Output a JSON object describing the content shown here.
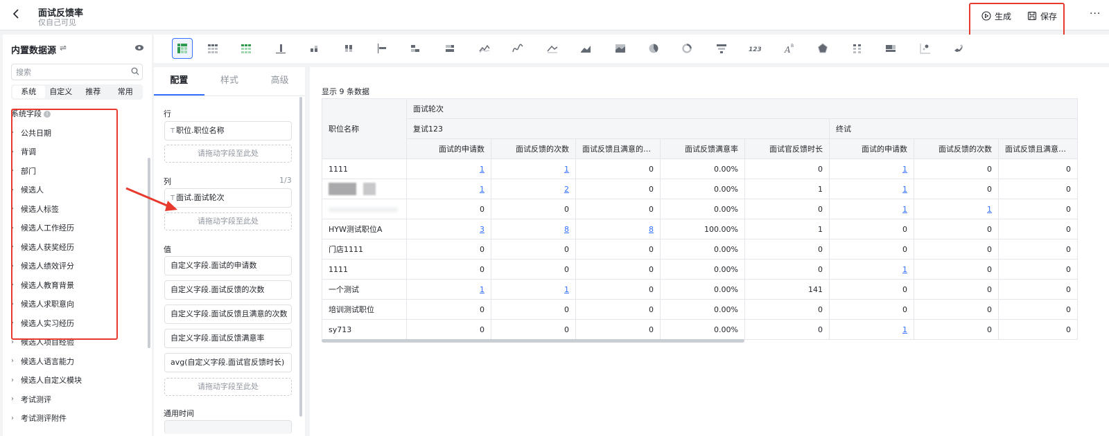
{
  "header": {
    "back_icon": "chevron-left-icon",
    "title": "面试反馈率",
    "subtitle": "仅自己可见",
    "generate_label": "生成",
    "save_label": "保存",
    "more_label": "···",
    "highlight_color": "#e8392d"
  },
  "left_panel": {
    "title": "内置数据源",
    "search_placeholder": "搜索",
    "tabs": [
      "系统",
      "自定义",
      "推荐",
      "常用"
    ],
    "active_tab": "系统",
    "section_label": "系统字段",
    "fields": [
      "公共日期",
      "背调",
      "部门",
      "候选人",
      "候选人标签",
      "候选人工作经历",
      "候选人获奖经历",
      "候选人绩效评分",
      "候选人教育背景",
      "候选人求职意向",
      "候选人实习经历",
      "候选人项目经验",
      "候选人语言能力",
      "候选人自定义模块",
      "考试测评",
      "考试测评附件"
    ]
  },
  "config_panel": {
    "tabs": [
      "配置",
      "样式",
      "高级"
    ],
    "active_tab": "配置",
    "rows_label": "行",
    "row_fields": [
      "职位.职位名称"
    ],
    "columns_label": "列",
    "columns_count": "1/3",
    "column_fields": [
      "面试.面试轮次"
    ],
    "values_label": "值",
    "value_fields": [
      "自定义字段.面试的申请数",
      "自定义字段.面试反馈的次数",
      "自定义字段.面试反馈且满意的次数",
      "自定义字段.面试反馈满意率",
      "avg(自定义字段.面试官反馈时长)"
    ],
    "drop_hint": "请拖动字段至此处",
    "time_label": "通用时间"
  },
  "table": {
    "count_text": "显示 9 条数据",
    "row_header": "职位名称",
    "column_dimension": "面试轮次",
    "groups": [
      "复试123",
      "终试"
    ],
    "measures": [
      "面试的申请数",
      "面试反馈的次数",
      "面试反馈且满意的次数",
      "面试反馈满意率",
      "面试官反馈时长"
    ],
    "rows": [
      {
        "name": "1111",
        "c": [
          "1",
          "1",
          "0",
          "0.00%",
          "0",
          "1",
          "0",
          "0"
        ],
        "links": [
          0,
          1,
          5
        ]
      },
      {
        "name": "",
        "c": [
          "1",
          "2",
          "0",
          "0.00%",
          "1",
          "1",
          "0",
          "0"
        ],
        "links": [
          0,
          1,
          5
        ],
        "blur": "a"
      },
      {
        "name": "",
        "c": [
          "0",
          "0",
          "0",
          "0.00%",
          "0",
          "1",
          "1",
          "0"
        ],
        "links": [
          5,
          6
        ],
        "blur": "c"
      },
      {
        "name": "HYW测试职位A",
        "c": [
          "3",
          "8",
          "8",
          "100.00%",
          "1",
          "0",
          "0",
          "0"
        ],
        "links": [
          0,
          1,
          2
        ]
      },
      {
        "name": "门店1111",
        "c": [
          "0",
          "0",
          "0",
          "0.00%",
          "0",
          "0",
          "0",
          "0"
        ],
        "links": []
      },
      {
        "name": "1111",
        "c": [
          "0",
          "0",
          "0",
          "0.00%",
          "0",
          "1",
          "0",
          "0"
        ],
        "links": [
          5
        ]
      },
      {
        "name": "一个测试",
        "c": [
          "1",
          "1",
          "0",
          "0.00%",
          "141",
          "0",
          "0",
          "0"
        ],
        "links": [
          0,
          1
        ]
      },
      {
        "name": "培训测试职位",
        "c": [
          "0",
          "0",
          "0",
          "0.00%",
          "0",
          "0",
          "0",
          "0"
        ],
        "links": []
      },
      {
        "name": "sy713",
        "c": [
          "0",
          "0",
          "0",
          "0.00%",
          "0",
          "1",
          "0",
          "0"
        ],
        "links": [
          5
        ]
      }
    ]
  },
  "toolbar_icons": [
    "pivot-table-icon",
    "table-icon",
    "detail-table-icon",
    "column-chart-icon",
    "stacked-column-icon",
    "grouped-column-icon",
    "bar-chart-icon",
    "stacked-bar-icon",
    "percent-bar-icon",
    "line-chart-icon",
    "smooth-line-icon",
    "area-chart-icon",
    "stacked-area-icon",
    "percent-area-icon",
    "pie-chart-icon",
    "donut-chart-icon",
    "funnel-chart-icon",
    "number-card-icon",
    "word-cloud-icon",
    "radar-chart-icon",
    "matrix-icon",
    "heatmap-icon",
    "scatter-icon",
    "map-icon"
  ],
  "colors": {
    "accent": "#3370ff",
    "border": "#e5e6eb",
    "muted": "#8f959e"
  }
}
